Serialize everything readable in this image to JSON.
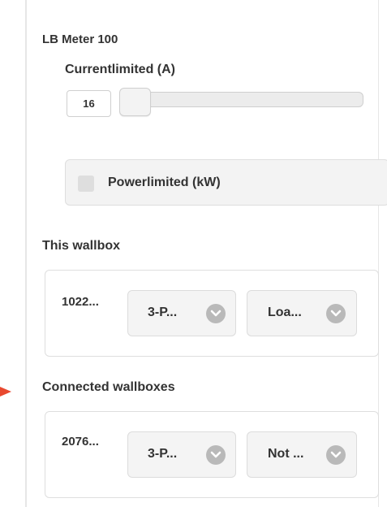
{
  "meter": {
    "title": "LB Meter 100",
    "current_label": "Currentlimited (A)",
    "current_value": "16",
    "power_label": "Powerlimited (kW)"
  },
  "this_wallbox": {
    "title": "This wallbox",
    "id": "1022...",
    "phase_select": "3-P...",
    "mode_select": "Loa..."
  },
  "connected_wallboxes": {
    "title": "Connected wallboxes",
    "id": "2076...",
    "phase_select": "3-P...",
    "mode_select": "Not ..."
  },
  "colors": {
    "accent_arrow": "#e8492f",
    "select_background": "#f4f4f4",
    "chevron_circle": "#b9b9b9"
  }
}
